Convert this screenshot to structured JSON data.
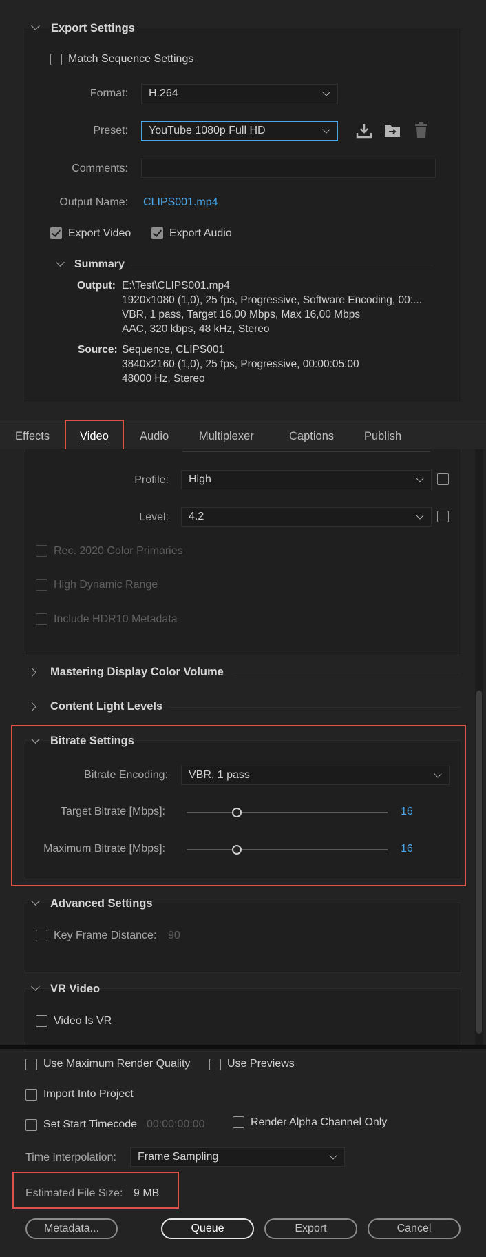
{
  "export_settings": {
    "header": "Export Settings",
    "match_sequence": "Match Sequence Settings",
    "format_label": "Format:",
    "format_value": "H.264",
    "preset_label": "Preset:",
    "preset_value": "YouTube 1080p Full HD",
    "comments_label": "Comments:",
    "comments_value": "",
    "output_name_label": "Output Name:",
    "output_name_value": "CLIPS001.mp4",
    "export_video": "Export Video",
    "export_audio": "Export Audio"
  },
  "summary": {
    "header": "Summary",
    "output_label": "Output:",
    "output_lines": [
      "E:\\Test\\CLIPS001.mp4",
      "1920x1080 (1,0), 25 fps, Progressive, Software Encoding, 00:...",
      "VBR, 1 pass, Target 16,00 Mbps, Max 16,00 Mbps",
      "AAC, 320 kbps, 48 kHz, Stereo"
    ],
    "source_label": "Source:",
    "source_lines": [
      "Sequence, CLIPS001",
      "3840x2160 (1,0), 25 fps, Progressive, 00:00:05:00",
      "48000 Hz, Stereo"
    ]
  },
  "tabs": [
    "Effects",
    "Video",
    "Audio",
    "Multiplexer",
    "Captions",
    "Publish"
  ],
  "video": {
    "profile_label": "Profile:",
    "profile_value": "High",
    "level_label": "Level:",
    "level_value": "4.2",
    "rec2020": "Rec. 2020 Color Primaries",
    "hdr": "High Dynamic Range",
    "hdr10": "Include HDR10 Metadata",
    "mastering": "Mastering Display Color Volume",
    "content_light": "Content Light Levels"
  },
  "bitrate": {
    "header": "Bitrate Settings",
    "encoding_label": "Bitrate Encoding:",
    "encoding_value": "VBR, 1 pass",
    "target_label": "Target Bitrate [Mbps]:",
    "target_value": "16",
    "target_fraction": 0.25,
    "max_label": "Maximum Bitrate [Mbps]:",
    "max_value": "16",
    "max_fraction": 0.25
  },
  "advanced": {
    "header": "Advanced Settings",
    "key_frame": "Key Frame Distance:",
    "key_frame_value": "90"
  },
  "vr": {
    "header": "VR Video",
    "is_vr": "Video Is VR"
  },
  "bottom": {
    "max_render": "Use Maximum Render Quality",
    "use_previews": "Use Previews",
    "import_project": "Import Into Project",
    "start_tc": "Set Start Timecode",
    "start_tc_value": "00:00:00:00",
    "alpha_only": "Render Alpha Channel Only",
    "time_interp_label": "Time Interpolation:",
    "time_interp_value": "Frame Sampling",
    "file_size_label": "Estimated File Size:",
    "file_size_value": "9 MB"
  },
  "buttons": {
    "metadata": "Metadata...",
    "queue": "Queue",
    "export": "Export",
    "cancel": "Cancel"
  },
  "colors": {
    "accent": "#4aa6e8",
    "highlight": "#e0504a"
  }
}
